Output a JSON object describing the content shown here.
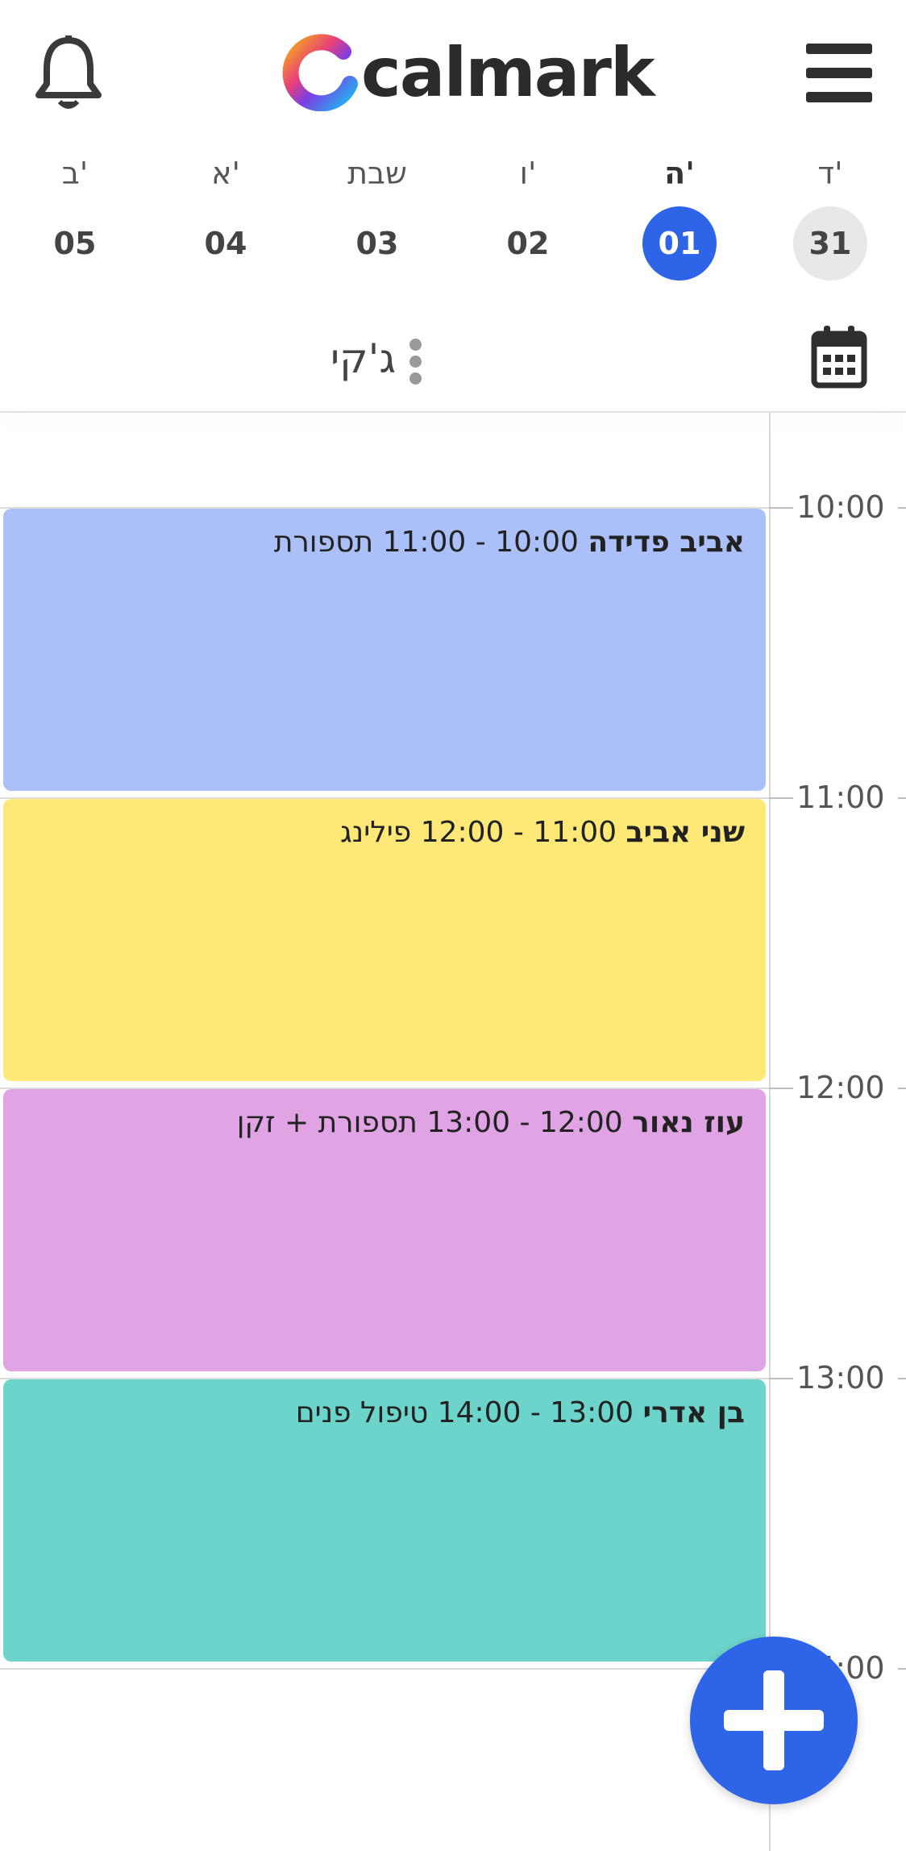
{
  "app": {
    "brand": "calmark"
  },
  "header": {
    "bell_icon": "bell-icon",
    "menu_icon": "hamburger-menu-icon"
  },
  "week": [
    {
      "name": "ד'",
      "num": "31",
      "state": "today"
    },
    {
      "name": "ה'",
      "num": "01",
      "state": "selected"
    },
    {
      "name": "ו'",
      "num": "02",
      "state": ""
    },
    {
      "name": "שבת",
      "num": "03",
      "state": ""
    },
    {
      "name": "א'",
      "num": "04",
      "state": ""
    },
    {
      "name": "ב'",
      "num": "05",
      "state": ""
    }
  ],
  "staff": {
    "name": "ג'קי",
    "calendar_icon": "calendar-icon",
    "more_icon": "more-vertical-icon"
  },
  "hours": [
    "10:00",
    "11:00",
    "12:00",
    "13:00",
    "14:00"
  ],
  "appointments": [
    {
      "client": "אביב פדידה",
      "time": "11:00 - 10:00",
      "service": "תספורת",
      "color": "#abc0f9"
    },
    {
      "client": "שני אביב",
      "time": "12:00 - 11:00",
      "service": "פילינג",
      "color": "#fde878"
    },
    {
      "client": "עוז נאור",
      "time": "13:00 - 12:00",
      "service": "תספורת + זקן",
      "color": "#e0a4e4"
    },
    {
      "client": "בן אדרי",
      "time": "14:00 - 13:00",
      "service": "טיפול פנים",
      "color": "#6cd4ca"
    }
  ],
  "colors": {
    "accent": "#2e64e8",
    "today_bg": "#e8e8e8"
  },
  "fab": {
    "icon": "plus-icon"
  }
}
